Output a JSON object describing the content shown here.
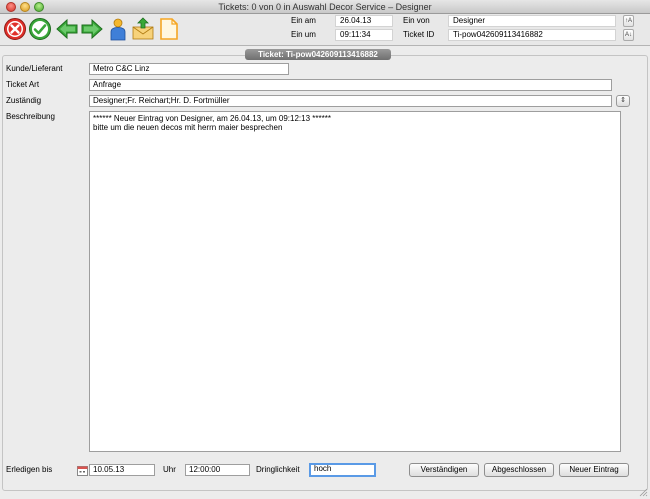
{
  "window": {
    "title": "Tickets: 0 von 0 in Auswahl Decor Service – Designer"
  },
  "toolbar": {
    "buttons": [
      {
        "icon": "cancel-icon",
        "color": "#e0302a"
      },
      {
        "icon": "checkmark-icon",
        "color": "#3aa63a"
      },
      {
        "icon": "arrow-left-icon",
        "color": "#38a838"
      },
      {
        "icon": "arrow-right-icon",
        "color": "#38a838"
      },
      {
        "icon": "person-icon",
        "color": "#f5b82e"
      },
      {
        "icon": "mail-upload-icon",
        "color": "#f0a020"
      },
      {
        "icon": "document-icon",
        "color": "#f5a623"
      }
    ]
  },
  "header": {
    "ein_am_label": "Ein am",
    "ein_am_value": "26.04.13",
    "ein_um_label": "Ein um",
    "ein_um_value": "09:11:34",
    "ein_von_label": "Ein von",
    "ein_von_value": "Designer",
    "ticket_id_label": "Ticket ID",
    "ticket_id_value": "Ti-pow042609113416882",
    "sort_asc_label": "↑A",
    "sort_desc_label": "A↓"
  },
  "ticket": {
    "tab_label": "Ticket: Ti-pow042609113416882"
  },
  "form": {
    "kunde_label": "Kunde/Lieferant",
    "kunde_value": "Metro  C&C Linz",
    "art_label": "Ticket Art",
    "art_value": "Anfrage",
    "zustaendig_label": "Zuständig",
    "zustaendig_value": "Designer;Fr. Reichart;Hr. D. Fortmüller",
    "beschreibung_label": "Beschreibung",
    "beschreibung_line1": "****** Neuer Eintrag von Designer, am 26.04.13, um 09:12:13 ******",
    "beschreibung_line2": "bitte um die neuen decos mit herrn maier besprechen"
  },
  "footer": {
    "erledigen_label": "Erledigen bis",
    "erledigen_value": "10.05.13",
    "uhr_label": "Uhr",
    "uhr_value": "12:00:00",
    "dringlichkeit_label": "Dringlichkeit",
    "dringlichkeit_value": "hoch",
    "btn_verstaendigen": "Verständigen",
    "btn_abgeschlossen": "Abgeschlossen",
    "btn_neuer_eintrag": "Neuer Eintrag"
  }
}
